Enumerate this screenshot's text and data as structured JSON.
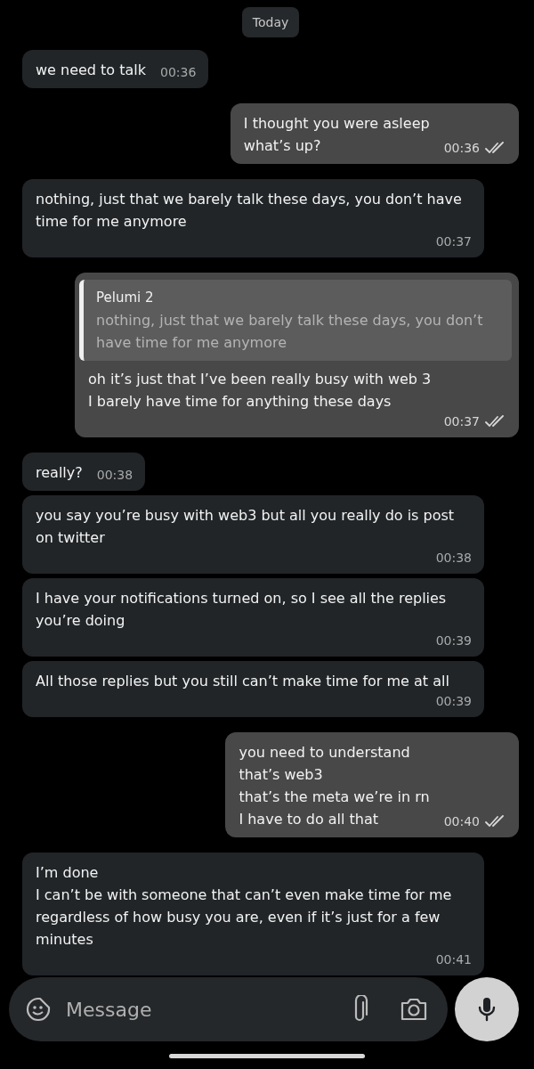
{
  "date_chip": "Today",
  "messages": [
    {
      "kind": "incoming",
      "text": "we need to talk",
      "time": "00:36"
    },
    {
      "kind": "outgoing",
      "text": "I thought you were asleep\nwhat’s up?",
      "time": "00:36",
      "read": true
    },
    {
      "kind": "incoming",
      "text": "nothing, just that we barely talk these days, you don’t have time for me anymore",
      "time": "00:37"
    },
    {
      "kind": "outgoing",
      "quote": {
        "author": "Pelumi 2",
        "text": "nothing, just that we barely talk these days, you don’t have time for me anymore"
      },
      "text": "oh it’s just that I’ve been really busy with web 3\nI barely have time for anything these days",
      "time": "00:37",
      "read": true
    },
    {
      "kind": "incoming",
      "text": "really?",
      "time": "00:38"
    },
    {
      "kind": "incoming",
      "text": "you say you’re busy with web3 but all you really do is post on twitter",
      "time": "00:38"
    },
    {
      "kind": "incoming",
      "text": "I have your notifications turned on, so I see all the replies you’re doing",
      "time": "00:39"
    },
    {
      "kind": "incoming",
      "text": "All those replies but you still can’t make time for me at all",
      "time": "00:39"
    },
    {
      "kind": "outgoing",
      "text": "you need to understand\nthat’s web3\nthat’s the meta we’re in rn\nI have to do all that",
      "time": "00:40",
      "read": true
    },
    {
      "kind": "incoming",
      "text": "I’m done\nI can’t be with someone that can’t even make time for me\nregardless of how busy you are, even if it’s just for a few minutes",
      "time": "00:41"
    }
  ],
  "composer": {
    "placeholder": "Message"
  }
}
